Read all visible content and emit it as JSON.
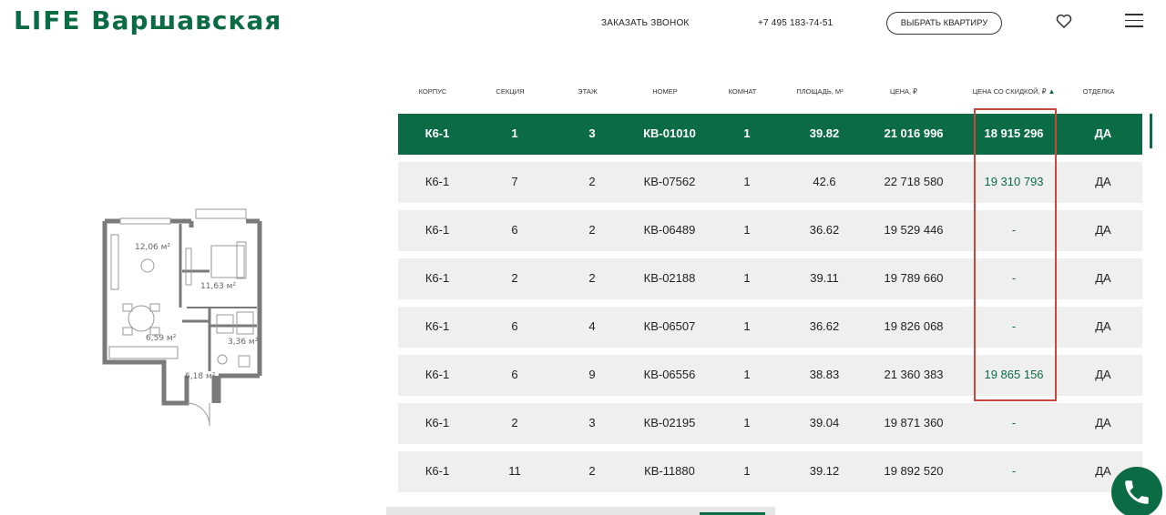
{
  "header": {
    "logo_prefix": "LIFE",
    "logo_name": "Варшавская",
    "callback_label": "ЗАКАЗАТЬ ЗВОНОК",
    "phone": "+7 495 183-74-51",
    "choose_label": "ВЫБРАТЬ КВАРТИРУ"
  },
  "plan": {
    "room1_area": "12,06 м²",
    "room2_area": "11,63 м²",
    "kitchen_area": "6,59 м²",
    "bath_area": "3,36 м²",
    "hall_area": "6,18 м²"
  },
  "table": {
    "columns": [
      "КОРПУС",
      "СЕКЦИЯ",
      "ЭТАЖ",
      "НОМЕР",
      "КОМНАТ",
      "ПЛОЩАДЬ, М²",
      "ЦЕНА, ₽",
      "ЦЕНА СО СКИДКОЙ, ₽",
      "ОТДЕЛКА"
    ],
    "sort_indicator": "▲",
    "rows": [
      {
        "building": "К6-1",
        "section": "1",
        "floor": "3",
        "number": "КВ-01010",
        "rooms": "1",
        "area": "39.82",
        "price": "21 016 996",
        "discount": "18 915 296",
        "finish": "ДА"
      },
      {
        "building": "К6-1",
        "section": "7",
        "floor": "2",
        "number": "КВ-07562",
        "rooms": "1",
        "area": "42.6",
        "price": "22 718 580",
        "discount": "19 310 793",
        "finish": "ДА"
      },
      {
        "building": "К6-1",
        "section": "6",
        "floor": "2",
        "number": "КВ-06489",
        "rooms": "1",
        "area": "36.62",
        "price": "19 529 446",
        "discount": "-",
        "finish": "ДА"
      },
      {
        "building": "К6-1",
        "section": "2",
        "floor": "2",
        "number": "КВ-02188",
        "rooms": "1",
        "area": "39.11",
        "price": "19 789 660",
        "discount": "-",
        "finish": "ДА"
      },
      {
        "building": "К6-1",
        "section": "6",
        "floor": "4",
        "number": "КВ-06507",
        "rooms": "1",
        "area": "36.62",
        "price": "19 826 068",
        "discount": "-",
        "finish": "ДА"
      },
      {
        "building": "К6-1",
        "section": "6",
        "floor": "9",
        "number": "КВ-06556",
        "rooms": "1",
        "area": "38.83",
        "price": "21 360 383",
        "discount": "19 865 156",
        "finish": "ДА"
      },
      {
        "building": "К6-1",
        "section": "2",
        "floor": "3",
        "number": "КВ-02195",
        "rooms": "1",
        "area": "39.04",
        "price": "19 871 360",
        "discount": "-",
        "finish": "ДА"
      },
      {
        "building": "К6-1",
        "section": "11",
        "floor": "2",
        "number": "КВ-11880",
        "rooms": "1",
        "area": "39.12",
        "price": "19 892 520",
        "discount": "-",
        "finish": "ДА"
      }
    ]
  },
  "colors": {
    "brand_green": "#0b6b45",
    "row_bg": "#efefef",
    "highlight_red": "#c9483b"
  },
  "icons": {
    "favorite": "heart-icon",
    "menu": "burger-menu-icon",
    "call": "phone-icon"
  }
}
